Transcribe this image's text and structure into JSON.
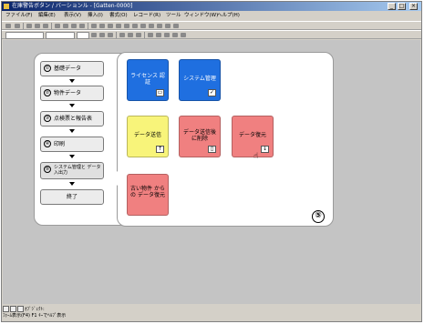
{
  "window": {
    "title": "在庫警告ボタン / バーションル - [Gatten-0000]",
    "controls": {
      "minimize": "_",
      "maximize": "□",
      "close": "×"
    }
  },
  "menubar": {
    "items": [
      "ファイル(F)",
      "編集(E)",
      "表示(V)",
      "挿入(I)",
      "書式(O)",
      "レコード(R)",
      "ツール",
      "ウィンドウ(W)",
      "ヘルプ(H)"
    ]
  },
  "nav": {
    "items": [
      {
        "num": "①",
        "label": "基礎データ"
      },
      {
        "num": "②",
        "label": "物件データ"
      },
      {
        "num": "③",
        "label": "点検票と報告表"
      },
      {
        "num": "④",
        "label": "印刷"
      },
      {
        "num": "⑤",
        "label": "システム管理と データ入出力"
      }
    ],
    "exit_label": "終了"
  },
  "panel": {
    "badge": "⑤",
    "tiles": [
      {
        "label": "ライセンス 認証",
        "color": "#1f6fe0"
      },
      {
        "label": "システム管理",
        "color": "#1f6fe0"
      },
      {
        "label": "データ送信",
        "color": "#f8f47a"
      },
      {
        "label": "データ送信後 に削除",
        "color": "#f08080"
      },
      {
        "label": "データ復元",
        "color": "#f08080"
      },
      {
        "label": "古い物件 からの データ復元",
        "color": "#f08080"
      }
    ]
  },
  "statusbar": {
    "sheet_label": "ｵﾌﾞｼﾞｪｸﾄ:",
    "text": "ﾌｫｰﾑ表示(F4) F1 ｷｰでﾍﾙﾌﾟ表示"
  }
}
